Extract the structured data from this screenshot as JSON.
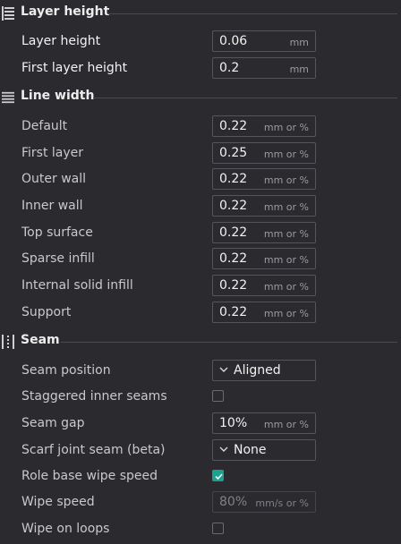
{
  "sections": {
    "layer_height": {
      "title": "Layer height",
      "rows": [
        {
          "label": "Layer height",
          "value": "0.06",
          "unit": "mm"
        },
        {
          "label": "First layer height",
          "value": "0.2",
          "unit": "mm"
        }
      ]
    },
    "line_width": {
      "title": "Line width",
      "rows": [
        {
          "label": "Default",
          "value": "0.22",
          "unit": "mm or %"
        },
        {
          "label": "First layer",
          "value": "0.25",
          "unit": "mm or %"
        },
        {
          "label": "Outer wall",
          "value": "0.22",
          "unit": "mm or %"
        },
        {
          "label": "Inner wall",
          "value": "0.22",
          "unit": "mm or %"
        },
        {
          "label": "Top surface",
          "value": "0.22",
          "unit": "mm or %"
        },
        {
          "label": "Sparse infill",
          "value": "0.22",
          "unit": "mm or %"
        },
        {
          "label": "Internal solid infill",
          "value": "0.22",
          "unit": "mm or %"
        },
        {
          "label": "Support",
          "value": "0.22",
          "unit": "mm or %"
        }
      ]
    },
    "seam": {
      "title": "Seam",
      "seam_position": {
        "label": "Seam position",
        "value": "Aligned"
      },
      "staggered": {
        "label": "Staggered inner seams",
        "checked": false
      },
      "seam_gap": {
        "label": "Seam gap",
        "value": "10%",
        "unit": "mm or %"
      },
      "scarf": {
        "label": "Scarf joint seam (beta)",
        "value": "None"
      },
      "role_base": {
        "label": "Role base wipe speed",
        "checked": true
      },
      "wipe_speed": {
        "label": "Wipe speed",
        "value": "80%",
        "unit": "mm/s or %",
        "disabled": true
      },
      "wipe_loops": {
        "label": "Wipe on loops",
        "checked": false
      }
    }
  },
  "colors": {
    "background": "#2b2b2f",
    "accent": "#17a38f"
  }
}
